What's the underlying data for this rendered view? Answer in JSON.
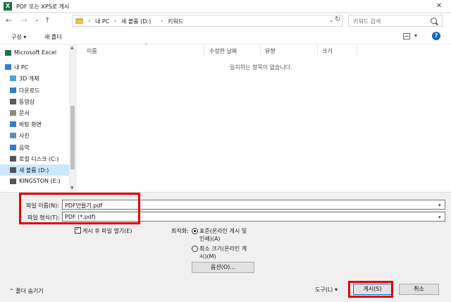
{
  "window": {
    "app_icon": "excel-icon",
    "app_icon_glyph": "X",
    "title": "PDF 또는 XPS로 게시",
    "close_glyph": "✕"
  },
  "nav": {
    "back_glyph": "←",
    "forward_glyph": "→",
    "dropdown_glyph": "⌄",
    "up_glyph": "↑",
    "breadcrumbs": [
      "내 PC",
      "새 볼륨 (D:)",
      "키워드"
    ],
    "separator": "›",
    "address_dropdown_glyph": "⌄",
    "refresh_glyph": "↻",
    "search_placeholder": "키워드 검색"
  },
  "toolbar": {
    "organize_label": "구성",
    "organize_glyph": "▾",
    "new_folder_label": "새 폴더",
    "view_dropdown_glyph": "▾",
    "help_glyph": "?"
  },
  "sidebar": {
    "items": [
      {
        "label": "Microsoft Excel",
        "icon": "excel-icon",
        "color": "#1e7145"
      },
      {
        "label": "내 PC",
        "icon": "pc-icon",
        "color": "#2f7fd1"
      },
      {
        "label": "3D 개체",
        "icon": "3d-objects-icon",
        "color": "#4aa3df"
      },
      {
        "label": "다운로드",
        "icon": "download-icon",
        "color": "#2f7fd1"
      },
      {
        "label": "동영상",
        "icon": "video-icon",
        "color": "#5a5a5a"
      },
      {
        "label": "문서",
        "icon": "document-icon",
        "color": "#8a8a8a"
      },
      {
        "label": "바탕 화면",
        "icon": "desktop-icon",
        "color": "#2f7fd1"
      },
      {
        "label": "사진",
        "icon": "pictures-icon",
        "color": "#5a8fc4"
      },
      {
        "label": "음악",
        "icon": "music-icon",
        "color": "#2f7fd1"
      },
      {
        "label": "로컬 디스크 (C:)",
        "icon": "disk-icon",
        "color": "#555555"
      },
      {
        "label": "새 볼륨 (D:)",
        "icon": "disk-icon",
        "color": "#555555"
      },
      {
        "label": "KINGSTON (E:)",
        "icon": "usb-drive-icon",
        "color": "#555555"
      }
    ],
    "selected_index": 10,
    "scroll_up_glyph": "▲",
    "scroll_down_glyph": "▼"
  },
  "filelist": {
    "columns": [
      "이름",
      "수정한 날짜",
      "유형",
      "크기"
    ],
    "sort_glyph": "^",
    "empty_message": "일치하는 항목이 없습니다."
  },
  "form": {
    "filename_label": "파일 이름(N):",
    "filename_value": "PDF만들기.pdf",
    "filetype_label": "파일 형식(T):",
    "filetype_value": "PDF (*.pdf)",
    "field_dropdown_glyph": "▾",
    "open_after_label": "게시 후 파일 열기(E)",
    "optimize_label": "최적화:",
    "opt_standard_line1": "표준(온라인 게시 및",
    "opt_standard_line2": "인쇄)(A)",
    "opt_minimum_line1": "최소 크기(온라인 게",
    "opt_minimum_line2": "시)(M)",
    "options_button": "옵션(O)...",
    "hide_folders_glyph": "⌃",
    "hide_folders_label": "폴더 숨기기",
    "tools_label": "도구(L)",
    "tools_glyph": "▾",
    "publish_button": "게시(S)",
    "cancel_button": "취소"
  },
  "colors": {
    "highlight": "#e00000",
    "accent": "#0078d7"
  }
}
